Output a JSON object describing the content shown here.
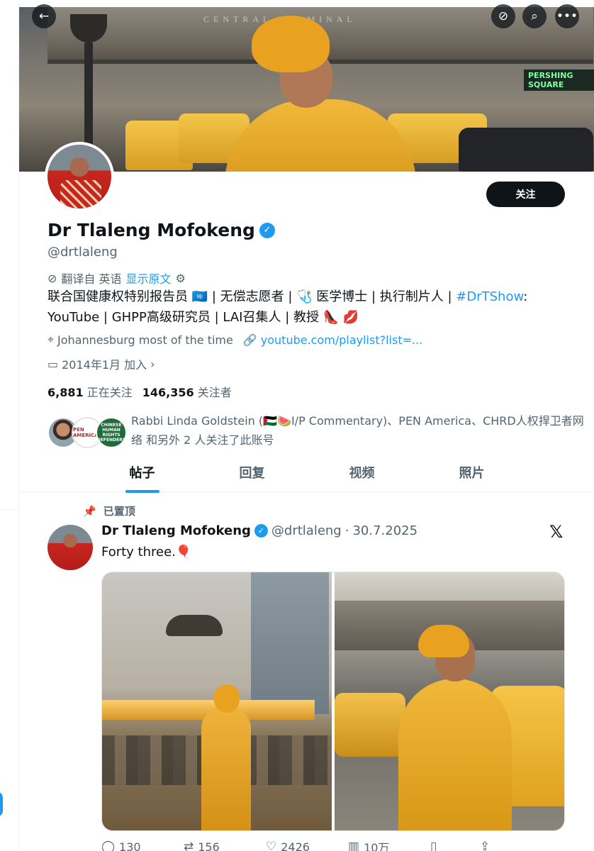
{
  "banner": {
    "arch_text": "CENTRAL TERMINAL",
    "sign_text": "PERSHING SQUARE"
  },
  "profile": {
    "display_name": "Dr Tlaleng Mofokeng",
    "handle": "@drtlaleng",
    "follow_label": "关注",
    "translate_label": "翻译自 英语",
    "show_original": "显示原文",
    "bio_line1": "联合国健康权特别报告员 🇺🇳 | 无偿志愿者 | 🩺 医学博士 | 执行制片人 | ",
    "bio_hashtag": "#DrTShow",
    "bio_line1_end": ":",
    "bio_line2": "YouTube | GHPP高级研究员 | LAI召集人 | 教授 👠 💋",
    "location": "Johannesburg most of the time",
    "website": "youtube.com/playlist?list=...",
    "joined": "2014年1月 加入",
    "following_count": "6,881",
    "following_label": "正在关注",
    "followers_count": "146,356",
    "followers_label": "关注者",
    "followed_by_text": "Rabbi Linda Goldstein (🇵🇸🍉I/P Commentary)、PEN America、CHRD人权捍卫者网络 和另外 2 人关注了此账号",
    "mini_avatar_2_text": "PEN AMERICA",
    "mini_avatar_3_text": "CHINESE HUMAN RIGHTS DEFENDERS"
  },
  "tabs": [
    {
      "label": "帖子"
    },
    {
      "label": "回复"
    },
    {
      "label": "视频"
    },
    {
      "label": "照片"
    }
  ],
  "post": {
    "pinned_label": "已置顶",
    "name": "Dr Tlaleng Mofokeng",
    "handle": "@drtlaleng",
    "separator": "·",
    "date": "30.7.2025",
    "text": "Forty three.🎈",
    "x_logo": "𝕏",
    "actions": {
      "replies": "130",
      "reposts": "156",
      "likes": "2426",
      "views": "10万"
    }
  },
  "colors": {
    "accent": "#1d9bf0",
    "text_primary": "#0f1419",
    "text_secondary": "#536471"
  }
}
